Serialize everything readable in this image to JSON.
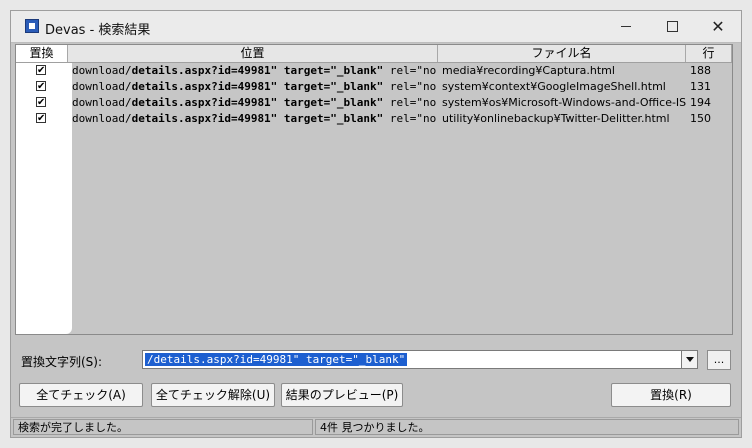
{
  "window": {
    "title": "Devas - 検索結果"
  },
  "list": {
    "columns": {
      "replace": "置換",
      "position": "位置",
      "filename": "ファイル名",
      "line": "行"
    },
    "rows": [
      {
        "checked": "✔",
        "pos_pre": "download/",
        "pos_bold": "details.aspx?id=49981\" target=\"_blank\"",
        "pos_post": " rel=\"no",
        "file": "media¥recording¥Captura.html",
        "line": "188"
      },
      {
        "checked": "✔",
        "pos_pre": "download/",
        "pos_bold": "details.aspx?id=49981\" target=\"_blank\"",
        "pos_post": " rel=\"no",
        "file": "system¥context¥GoogleImageShell.html",
        "line": "131"
      },
      {
        "checked": "✔",
        "pos_pre": "download/",
        "pos_bold": "details.aspx?id=49981\" target=\"_blank\"",
        "pos_post": " rel=\"no",
        "file": "system¥os¥Microsoft-Windows-and-Office-ISO",
        "line": "194"
      },
      {
        "checked": "✔",
        "pos_pre": "download/",
        "pos_bold": "details.aspx?id=49981\" target=\"_blank\"",
        "pos_post": " rel=\"no",
        "file": "utility¥onlinebackup¥Twitter-Delitter.html",
        "line": "150"
      }
    ]
  },
  "replace_label": "置換文字列(S):",
  "replace_value": "/details.aspx?id=49981\" target=\"_blank\"",
  "ellipsis_label": "...",
  "buttons": {
    "check_all": "全てチェック(A)",
    "uncheck_all": "全てチェック解除(U)",
    "preview": "結果のプレビュー(P)",
    "replace": "置換(R)"
  },
  "status": {
    "left": "検索が完了しました。",
    "right": "4件 見つかりました。"
  }
}
